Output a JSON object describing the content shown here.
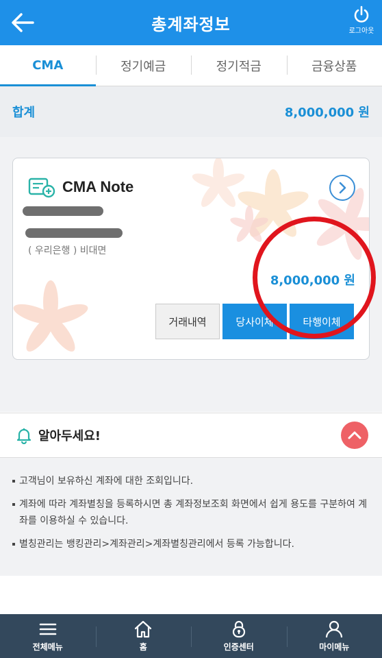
{
  "header": {
    "title": "총계좌정보",
    "logout_label": "로그아웃"
  },
  "tabs": [
    {
      "label": "CMA",
      "active": true
    },
    {
      "label": "정기예금",
      "active": false
    },
    {
      "label": "정기적금",
      "active": false
    },
    {
      "label": "금융상품",
      "active": false
    }
  ],
  "summary": {
    "label": "합계",
    "value": "8,000,000 원"
  },
  "account": {
    "name": "CMA Note",
    "bank_line": "( 우리은행 ) 비대면",
    "balance": "8,000,000 원",
    "buttons": {
      "history": "거래내역",
      "internal": "당사이체",
      "external": "타행이체"
    }
  },
  "notice": {
    "title": "알아두세요!",
    "items": [
      "고객님이 보유하신 계좌에 대한 조회입니다.",
      "계좌에 따라 계좌별칭을 등록하시면 총 계좌정보조회 화면에서 쉽게 용도를 구분하여 계좌를 이용하실 수 있습니다.",
      "별칭관리는 뱅킹관리>계좌관리>계좌별칭관리에서 등록 가능합니다."
    ]
  },
  "bottom_nav": [
    {
      "label": "전체메뉴",
      "icon": "menu-icon"
    },
    {
      "label": "홈",
      "icon": "home-icon"
    },
    {
      "label": "인증센터",
      "icon": "lock-icon"
    },
    {
      "label": "마이메뉴",
      "icon": "user-icon"
    }
  ],
  "colors": {
    "header": "#1e90e8",
    "accent": "#1a8fd6",
    "annotation": "#e0151d",
    "nav": "#33485c"
  }
}
